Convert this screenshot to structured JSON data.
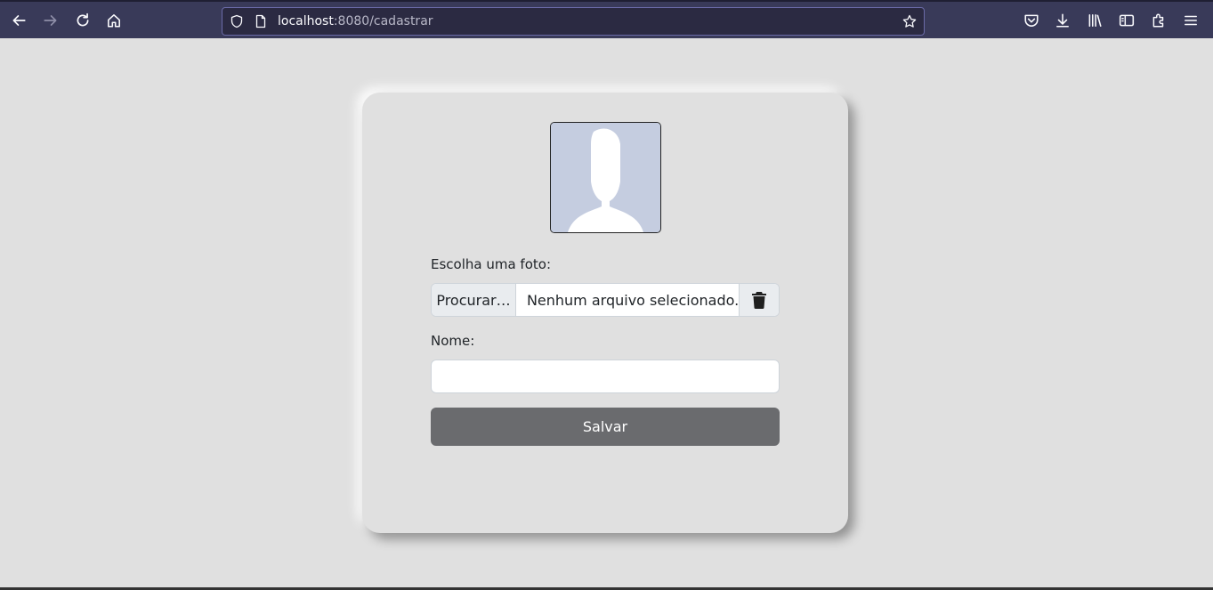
{
  "browser": {
    "url_host": "localhost",
    "url_path": ":8080/cadastrar"
  },
  "form": {
    "photo_label": "Escolha uma foto:",
    "browse_label": "Procurar…",
    "file_status": "Nenhum arquivo selecionado.",
    "name_label": "Nome:",
    "name_value": "",
    "save_label": "Salvar"
  },
  "icons": {
    "back": "arrow-left-icon",
    "forward": "arrow-right-icon",
    "reload": "reload-icon",
    "home": "home-icon",
    "shield": "shield-icon",
    "page": "page-icon",
    "bookmark": "star-icon",
    "pocket": "pocket-icon",
    "downloads": "download-icon",
    "library": "library-icon",
    "sidebar": "sidebar-icon",
    "extensions": "puzzle-icon",
    "menu": "hamburger-menu-icon",
    "trash": "trash-icon",
    "avatar": "person-silhouette-icon"
  },
  "colors": {
    "page_bg": "#e0e0e0",
    "toolbar_bg": "#393a59",
    "save_button": "#6a6b6e",
    "avatar_bg": "#c5cde0"
  }
}
